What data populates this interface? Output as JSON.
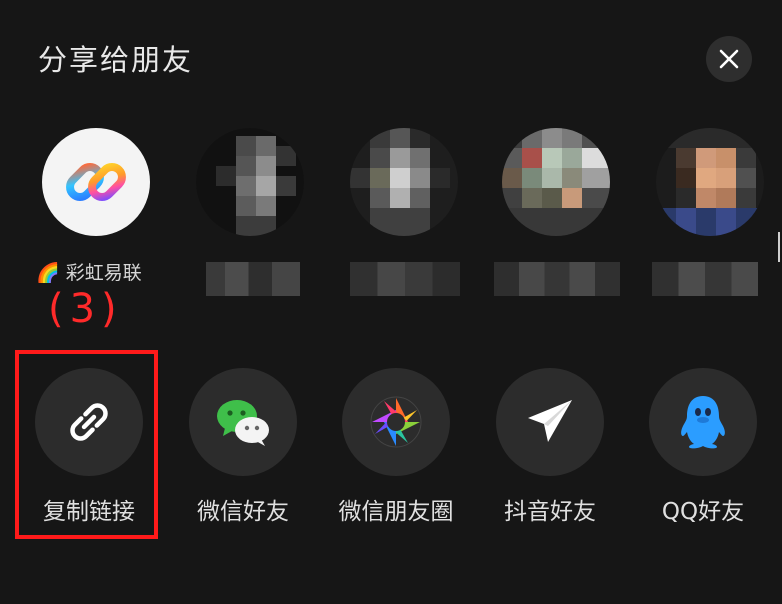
{
  "header": {
    "title": "分享给朋友",
    "close_icon": "close-icon"
  },
  "contacts": [
    {
      "name": "彩虹易联",
      "emoji": "🌈",
      "avatar": "rainbow-link-logo"
    },
    {
      "name": "",
      "avatar": "pixelated-avatar"
    },
    {
      "name": "",
      "avatar": "pixelated-avatar"
    },
    {
      "name": "",
      "avatar": "pixelated-avatar"
    },
    {
      "name": "",
      "avatar": "pixelated-avatar"
    }
  ],
  "annotation": {
    "step_label": "(3)",
    "highlight_color": "#ff1a1a"
  },
  "actions": [
    {
      "label": "复制链接",
      "icon": "link-icon"
    },
    {
      "label": "微信好友",
      "icon": "wechat-icon"
    },
    {
      "label": "微信朋友圈",
      "icon": "moments-icon"
    },
    {
      "label": "抖音好友",
      "icon": "paper-plane-icon"
    },
    {
      "label": "QQ好友",
      "icon": "qq-penguin-icon"
    }
  ],
  "colors": {
    "background": "#161616",
    "icon_circle": "#2c2c2c",
    "wechat_green": "#3fbf4a",
    "qq_blue": "#2b9dff"
  }
}
